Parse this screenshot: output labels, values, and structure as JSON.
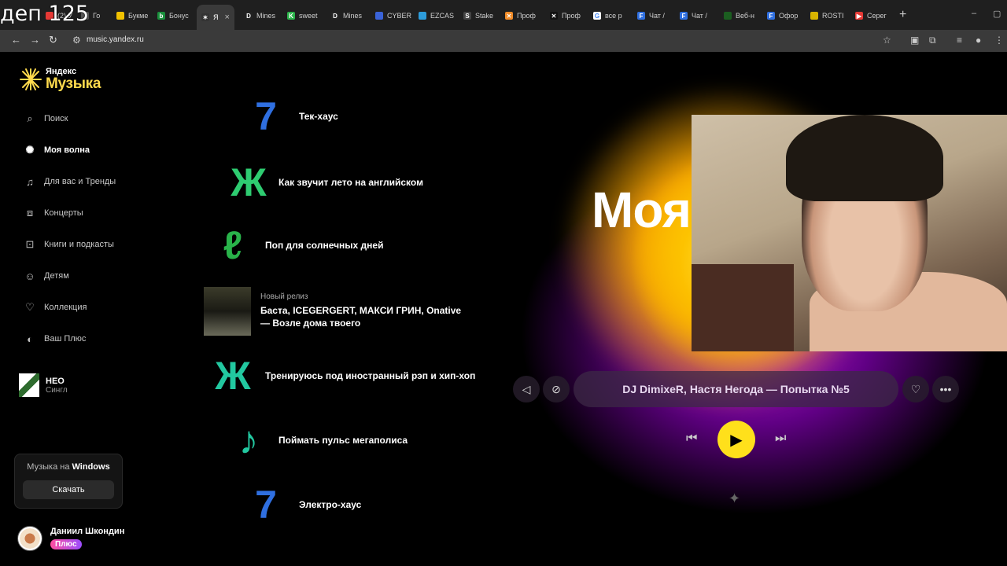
{
  "overlay": {
    "text": "деп 125"
  },
  "browser": {
    "tabs": [
      {
        "label": "(2) У",
        "icon": "red-icon"
      },
      {
        "label": "Го",
        "icon": "blue-icon"
      },
      {
        "label": "Букме",
        "icon": "yellow-icon"
      },
      {
        "label": "Бонус",
        "icon": "green-b-icon"
      },
      {
        "label": "Я",
        "icon": "yandex-music-icon",
        "active": true
      },
      {
        "label": "Mines",
        "icon": "d-icon"
      },
      {
        "label": "sweet",
        "icon": "k-icon"
      },
      {
        "label": "Mines",
        "icon": "d-icon"
      },
      {
        "label": "CYBER",
        "icon": "shield-icon"
      },
      {
        "label": "EZCAS",
        "icon": "globe-icon"
      },
      {
        "label": "Stake",
        "icon": "s-icon"
      },
      {
        "label": "Проф",
        "icon": "x-orange-icon"
      },
      {
        "label": "Проф",
        "icon": "x-icon"
      },
      {
        "label": "все р",
        "icon": "google-icon"
      },
      {
        "label": "Чат /",
        "icon": "f-icon"
      },
      {
        "label": "Чат /",
        "icon": "f-icon"
      },
      {
        "label": "Веб-н",
        "icon": "leaf-icon"
      },
      {
        "label": "Офор",
        "icon": "f-icon"
      },
      {
        "label": "ROSTI",
        "icon": "coin-icon"
      },
      {
        "label": "Серег",
        "icon": "youtube-icon"
      }
    ],
    "url": "music.yandex.ru"
  },
  "sidebar": {
    "logo_small": "Яндекс",
    "logo_big": "Музыка",
    "items": [
      {
        "label": "Поиск",
        "icon": "search-icon"
      },
      {
        "label": "Моя волна",
        "icon": "wave-icon",
        "active": true
      },
      {
        "label": "Для вас и Тренды",
        "icon": "music-note-icon"
      },
      {
        "label": "Концерты",
        "icon": "ticket-icon"
      },
      {
        "label": "Книги и подкасты",
        "icon": "book-icon"
      },
      {
        "label": "Детям",
        "icon": "kids-icon"
      },
      {
        "label": "Коллекция",
        "icon": "heart-icon"
      },
      {
        "label": "Ваш Плюс",
        "icon": "plus-icon"
      }
    ],
    "recent": {
      "title": "НЕО",
      "subtitle": "Сингл"
    },
    "windows_card": {
      "title_prefix": "Музыка на",
      "title_bold": "Windows",
      "button": "Скачать"
    },
    "user": {
      "name": "Даниил Шкондин",
      "badge": "Плюс"
    }
  },
  "main": {
    "moods": [
      {
        "label": "Тек-хаус"
      },
      {
        "label": "Как звучит лето на английском"
      },
      {
        "label": "Поп для солнечных дней"
      },
      {
        "label": "Тренируюсь под иностранный рэп и хип-хоп"
      },
      {
        "label": "Поймать пульс мегаполиса"
      },
      {
        "label": "Электро-хаус"
      }
    ],
    "release": {
      "tag": "Новый релиз",
      "title": "Баста, ICEGERGERT, МАКСИ ГРИН, Onative — Возле дома твоего"
    }
  },
  "wave": {
    "title": "Моя",
    "now_playing": "DJ DimixeR, Настя Негода — Попытка №5"
  },
  "colors": {
    "accent": "#ffdb4d",
    "play": "#ffe01b",
    "wave_pink": "#e628ff"
  }
}
